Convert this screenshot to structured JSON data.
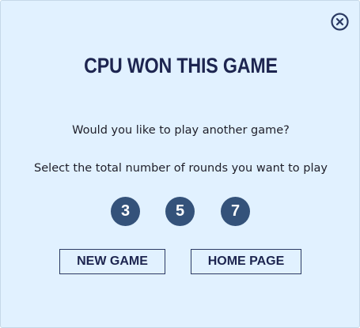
{
  "dialog": {
    "title": "CPU WON THIS GAME",
    "question": "Would you like to play another game?",
    "instruction": "Select the total number of rounds you want to play",
    "round_options": [
      "3",
      "5",
      "7"
    ],
    "new_game_label": "NEW GAME",
    "home_page_label": "HOME PAGE",
    "close_icon": "close-circle-icon"
  },
  "colors": {
    "background": "#e1f1ff",
    "title": "#1d2550",
    "round_button": "#34527a",
    "button_border": "#2b3a63"
  }
}
